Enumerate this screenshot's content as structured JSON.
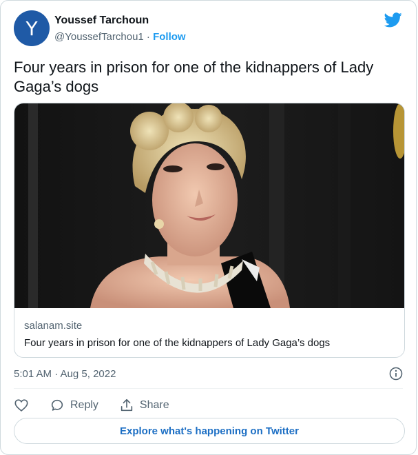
{
  "author": {
    "avatar_letter": "Y",
    "name": "Youssef Tarchoun",
    "handle": "@YoussefTarchou1",
    "separator": " · ",
    "follow_label": "Follow"
  },
  "brand_icon": "twitter-bird-icon",
  "tweet_text": "Four years in prison for one of the kidnappers of Lady Gaga’s dogs",
  "card": {
    "image_icon": "photo-of-woman-with-necklace",
    "domain": "salanam.site",
    "title": "Four years in prison for one of the kidnappers of Lady Gaga’s dogs"
  },
  "timestamp": "5:01 AM · Aug 5, 2022",
  "actions": {
    "like_icon": "heart-icon",
    "reply_label": "Reply",
    "share_label": "Share"
  },
  "explore_label": "Explore what's happening on Twitter",
  "colors": {
    "accent": "#1d9bf0",
    "avatar_bg": "#1f5aa6",
    "muted_text": "#536471",
    "border": "#cfd9de"
  }
}
